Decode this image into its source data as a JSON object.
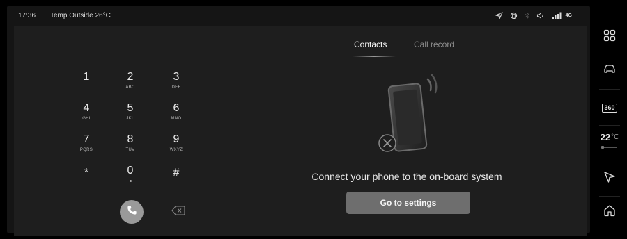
{
  "status_bar": {
    "time": "17:36",
    "temp_outside": "Temp Outside 26°C",
    "network": "4G",
    "icons": [
      "navigation-icon",
      "connected-device-icon",
      "bluetooth-icon",
      "volume-icon",
      "signal-icon"
    ]
  },
  "phone": {
    "tabs": [
      {
        "label": "Contacts",
        "active": true
      },
      {
        "label": "Call record",
        "active": false
      }
    ],
    "keypad": [
      {
        "digit": "1",
        "letters": ""
      },
      {
        "digit": "2",
        "letters": "ABC"
      },
      {
        "digit": "3",
        "letters": "DEF"
      },
      {
        "digit": "4",
        "letters": "GHI"
      },
      {
        "digit": "5",
        "letters": "JKL"
      },
      {
        "digit": "6",
        "letters": "MNO"
      },
      {
        "digit": "7",
        "letters": "PQRS"
      },
      {
        "digit": "8",
        "letters": "TUV"
      },
      {
        "digit": "9",
        "letters": "WXYZ"
      },
      {
        "digit": "*",
        "letters": ""
      },
      {
        "digit": "0",
        "letters": ""
      },
      {
        "digit": "#",
        "letters": ""
      }
    ],
    "connect_message": "Connect your phone to the on-board system",
    "settings_button": "Go to settings"
  },
  "sidebar": {
    "items": [
      "apps-grid-icon",
      "car-icon",
      "360-camera-icon",
      "climate-temperature",
      "navigation-icon",
      "home-icon"
    ],
    "camera_label": "360",
    "temperature": "22",
    "temperature_unit": "°C"
  },
  "colors": {
    "background": "#000000",
    "panel": "#1e1e1e",
    "button": "#6e6e6e",
    "call_button": "#9a9a9a",
    "inactive_text": "#8e8e8e"
  }
}
